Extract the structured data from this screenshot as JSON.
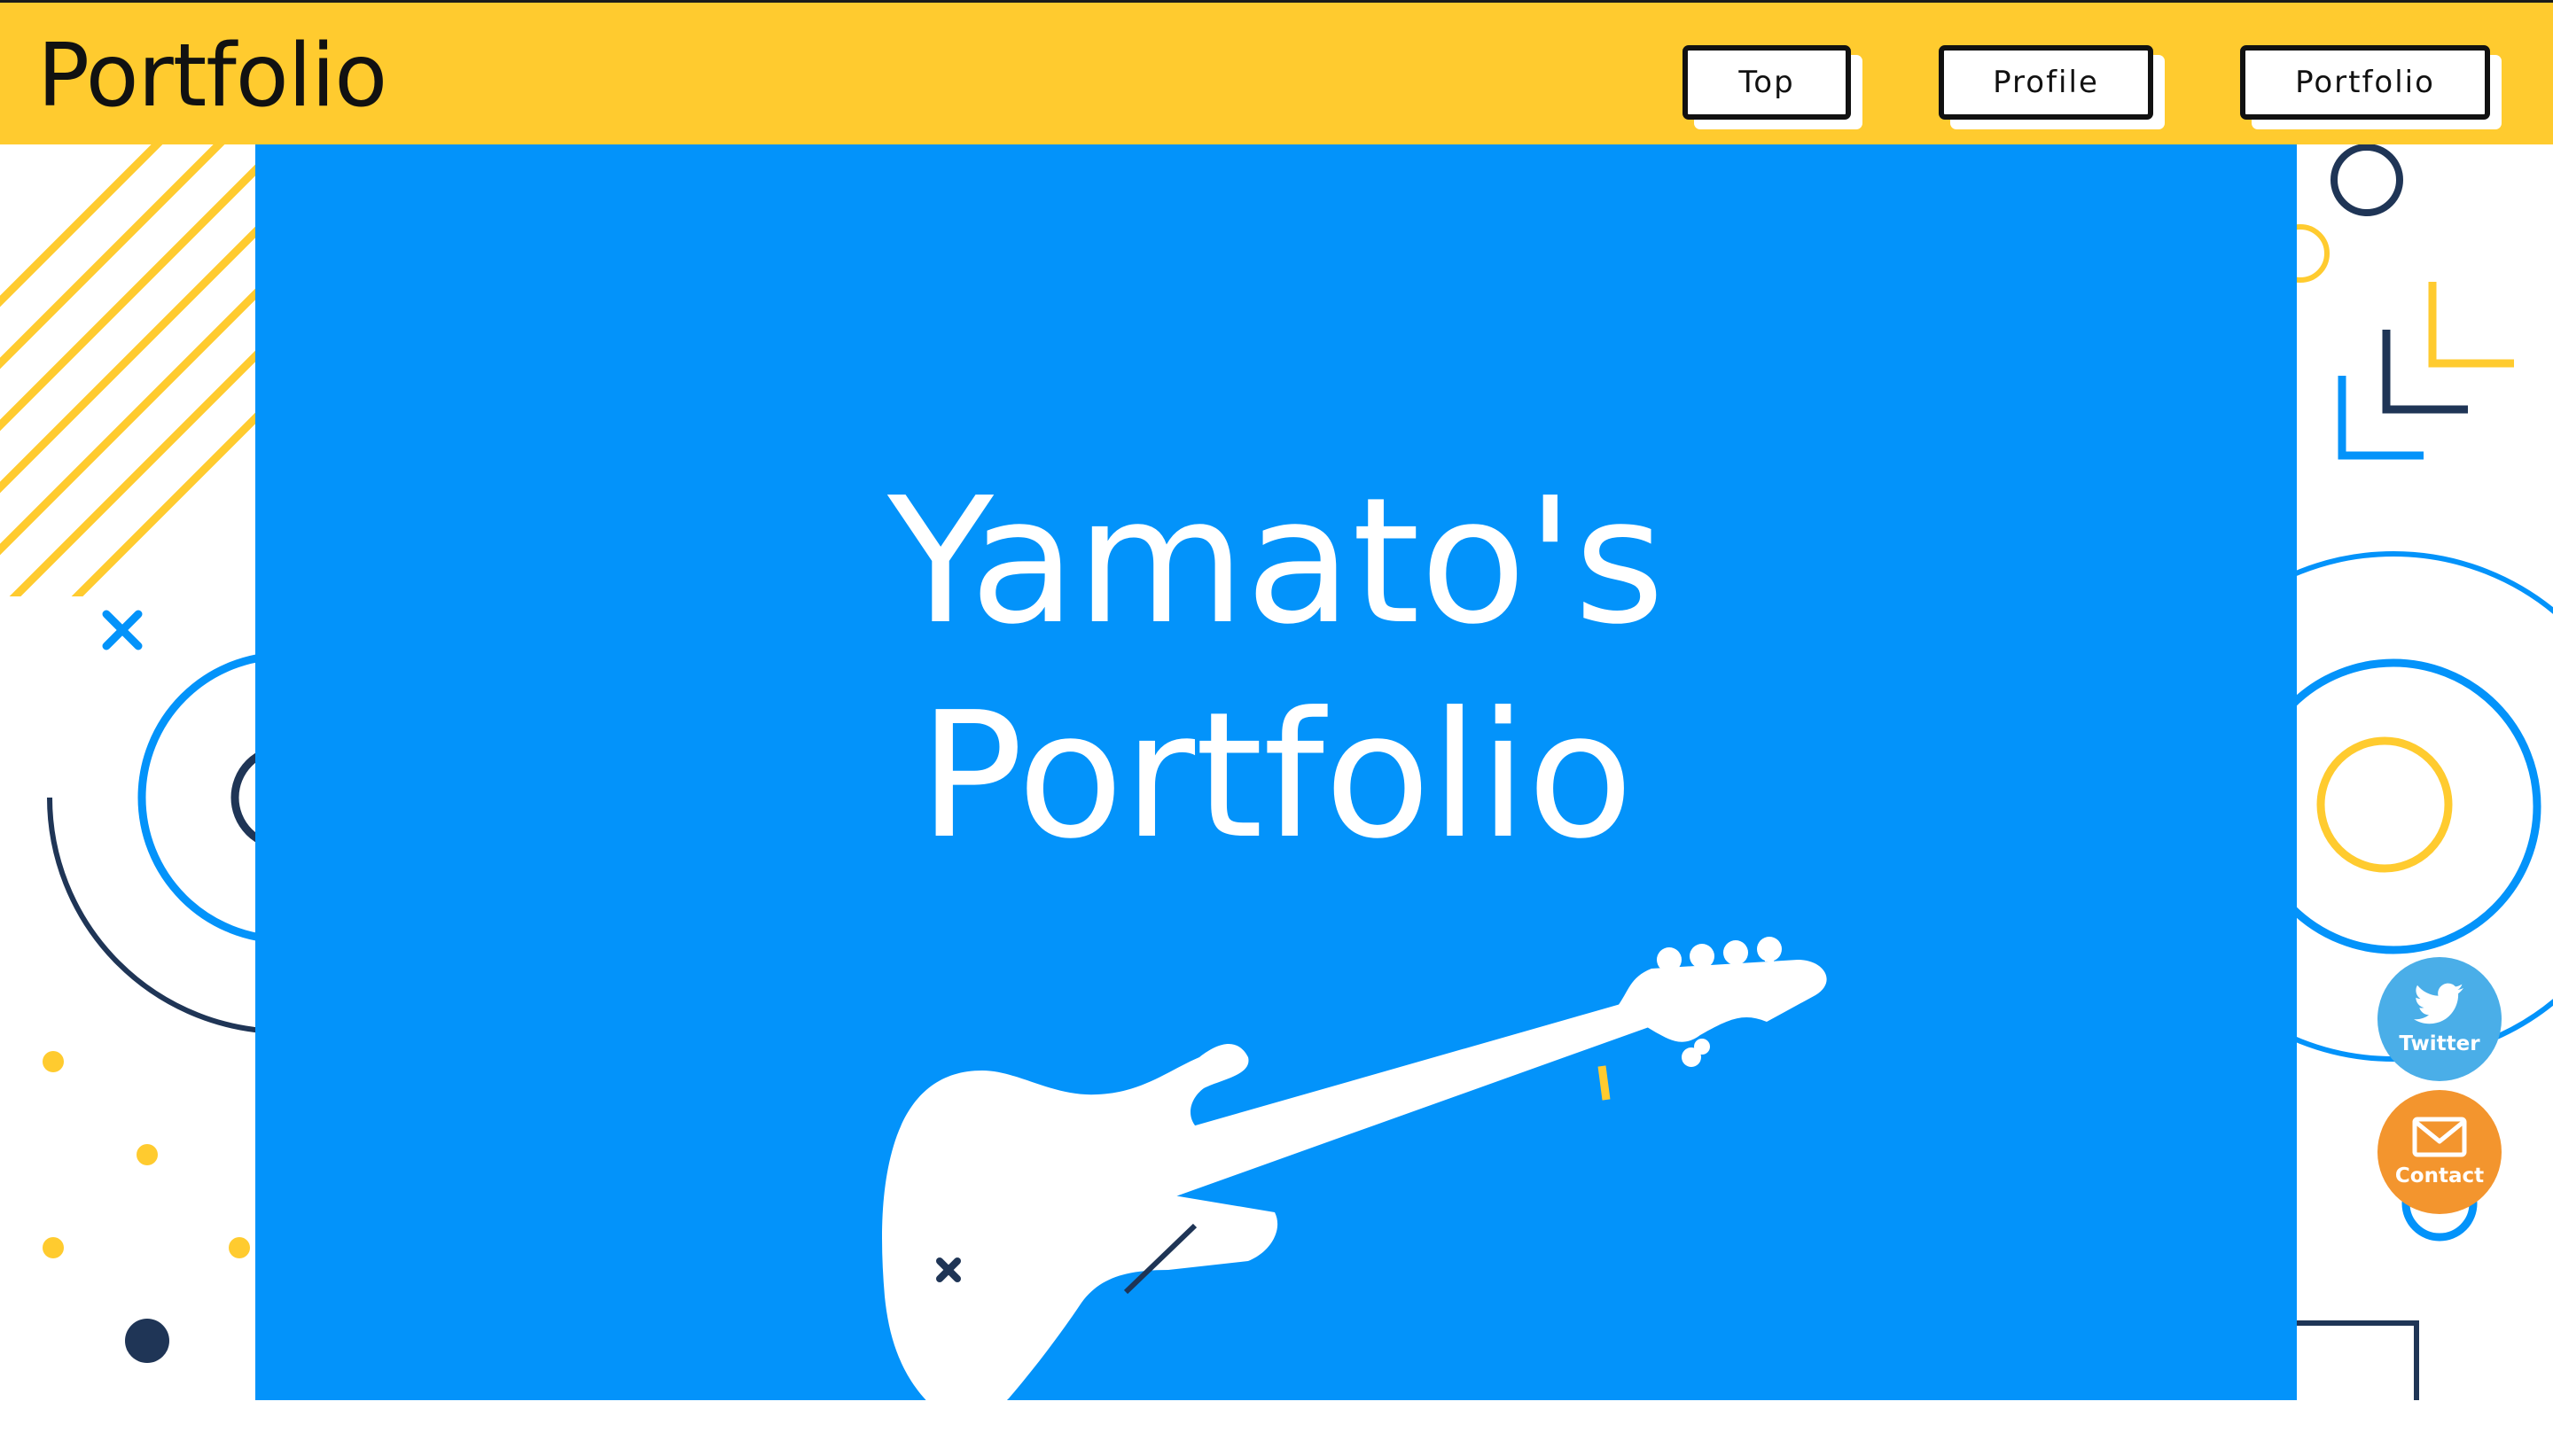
{
  "header": {
    "logo": "Portfolio",
    "nav": [
      {
        "label": "Top"
      },
      {
        "label": "Profile"
      },
      {
        "label": "Portfolio"
      }
    ]
  },
  "hero": {
    "title_line1": "Yamato's",
    "title_line2": "Portfolio",
    "illustration": "bass-guitar-silhouette"
  },
  "floating_buttons": [
    {
      "label": "Twitter",
      "icon": "twitter-bird-icon",
      "color": "#4aaee8"
    },
    {
      "label": "Contact",
      "icon": "envelope-icon",
      "color": "#f3952e"
    }
  ],
  "colors": {
    "header_bg": "#ffcb2f",
    "hero_bg": "#0393fa",
    "accent_yellow": "#ffcb2f",
    "accent_blue": "#0393fa",
    "navy": "#1f3556"
  }
}
